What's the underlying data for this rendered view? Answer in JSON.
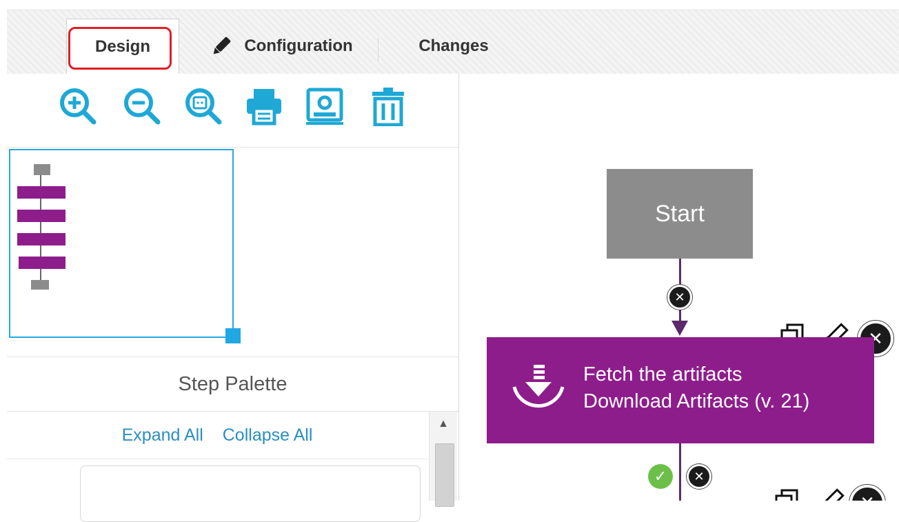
{
  "tabs": [
    {
      "label": "Design",
      "active": true,
      "highlighted": true
    },
    {
      "label": "Configuration",
      "icon": "pencil-icon"
    },
    {
      "label": "Changes"
    }
  ],
  "toolbar": {
    "buttons": [
      {
        "name": "zoom-in-button",
        "icon": "zoom-in-icon"
      },
      {
        "name": "zoom-out-button",
        "icon": "zoom-out-icon"
      },
      {
        "name": "zoom-fit-button",
        "icon": "zoom-fit-icon"
      },
      {
        "name": "print-button",
        "icon": "print-icon"
      },
      {
        "name": "export-image-button",
        "icon": "image-export-icon"
      },
      {
        "name": "delete-button",
        "icon": "trash-icon"
      }
    ],
    "color": "#1fa8d6"
  },
  "palette": {
    "title": "Step Palette",
    "expand_all": "Expand All",
    "collapse_all": "Collapse All"
  },
  "canvas": {
    "start_label": "Start",
    "step": {
      "line1": "Fetch the artifacts",
      "line2": "Download Artifacts (v. 21)",
      "color": "#8e1d8c"
    },
    "start_color": "#8c8c8c",
    "wire_color": "#5b2a6a"
  }
}
